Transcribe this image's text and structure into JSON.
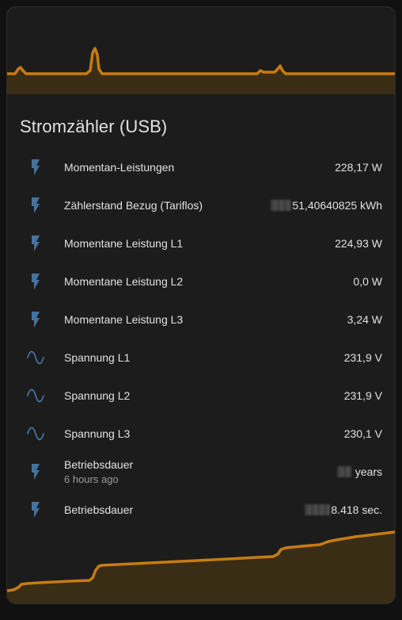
{
  "card": {
    "title": "Stromzähler (USB)",
    "accent_color": "#c77c12",
    "icon_color": "#44739e"
  },
  "rows": [
    {
      "label": "Momentan-Leistungen",
      "value": "228,17 W",
      "icon": "flash-icon"
    },
    {
      "label": "Zählerstand Bezug (Tariflos)",
      "value": "51,40640825 kWh",
      "icon": "flash-icon",
      "value_obscured": true
    },
    {
      "label": "Momentane Leistung L1",
      "value": "224,93 W",
      "icon": "flash-icon"
    },
    {
      "label": "Momentane Leistung L2",
      "value": "0,0 W",
      "icon": "flash-icon"
    },
    {
      "label": "Momentane Leistung L3",
      "value": "3,24 W",
      "icon": "flash-icon"
    },
    {
      "label": "Spannung L1",
      "value": "231,9 V",
      "icon": "sine-wave-icon"
    },
    {
      "label": "Spannung L2",
      "value": "231,9 V",
      "icon": "sine-wave-icon"
    },
    {
      "label": "Spannung L3",
      "value": "230,1 V",
      "icon": "sine-wave-icon"
    },
    {
      "label": "Betriebsdauer",
      "secondary": "6 hours ago",
      "value": "years",
      "icon": "flash-icon",
      "value_obscured": true
    },
    {
      "label": "Betriebsdauer",
      "value": "8.418 sec.",
      "icon": "flash-icon",
      "value_obscured": true
    }
  ]
}
